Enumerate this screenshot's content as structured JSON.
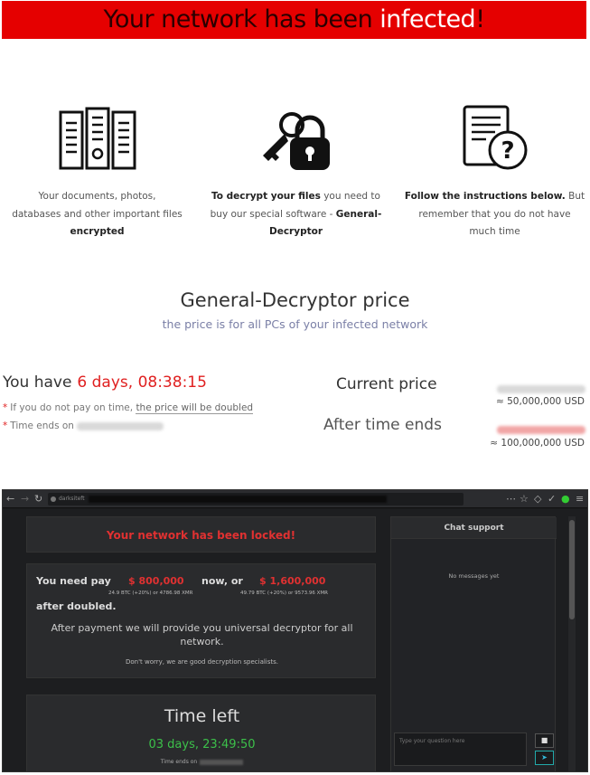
{
  "banner": {
    "text_main": "Your network has been ",
    "text_highlight": "infected",
    "text_end": "!"
  },
  "features": [
    {
      "icon": "server-rack-icon",
      "line1": "Your documents, photos,",
      "line2": "databases and other important files",
      "line3_bold": "encrypted"
    },
    {
      "icon": "keys-lock-icon",
      "line1_bold": "To decrypt your files",
      "line1_rest": " you need to",
      "line2": "buy our special software - ",
      "line2_bold": "General-",
      "line3_bold": "Decryptor"
    },
    {
      "icon": "document-question-icon",
      "line1_bold": "Follow the instructions below.",
      "line1_rest": " But",
      "line2": "remember that you do not have",
      "line3": "much time"
    }
  ],
  "price": {
    "title": "General-Decryptor price",
    "subtitle": "the price is for all PCs of your infected network"
  },
  "countdown": {
    "label": "You have",
    "timer": "6 days, 08:38:15"
  },
  "notes": {
    "note1_prefix": "If you do not pay on time, ",
    "note1_link": "the price will be doubled",
    "note2_prefix": "Time ends on"
  },
  "current_price": {
    "label": "Current price",
    "usd": "≈ 50,000,000 USD"
  },
  "after_price": {
    "label": "After time ends",
    "usd": "≈ 100,000,000 USD"
  },
  "browser": {
    "url_prefix": "darksiteft"
  },
  "locked": {
    "text": "Your network has been locked!"
  },
  "payment": {
    "line1": "You need pay",
    "amount_now": "$ 800,000",
    "now_or": "now, or",
    "amount_later": "$ 1,600,000",
    "sub_now": "24.9 BTC (+20%) or 4786.98 XMR",
    "sub_later": "49.79 BTC (+20%) or 9573.96 XMR",
    "line2": "after doubled.",
    "message": "After payment we will provide you universal decryptor for all network.",
    "reassure": "Don't worry, we are good decryption specialists."
  },
  "timer": {
    "title": "Time left",
    "value": "03 days, 23:49:50",
    "ends_label": "Time ends on"
  },
  "chat": {
    "title": "Chat support",
    "empty": "No messages yet",
    "placeholder": "Type your question here"
  }
}
